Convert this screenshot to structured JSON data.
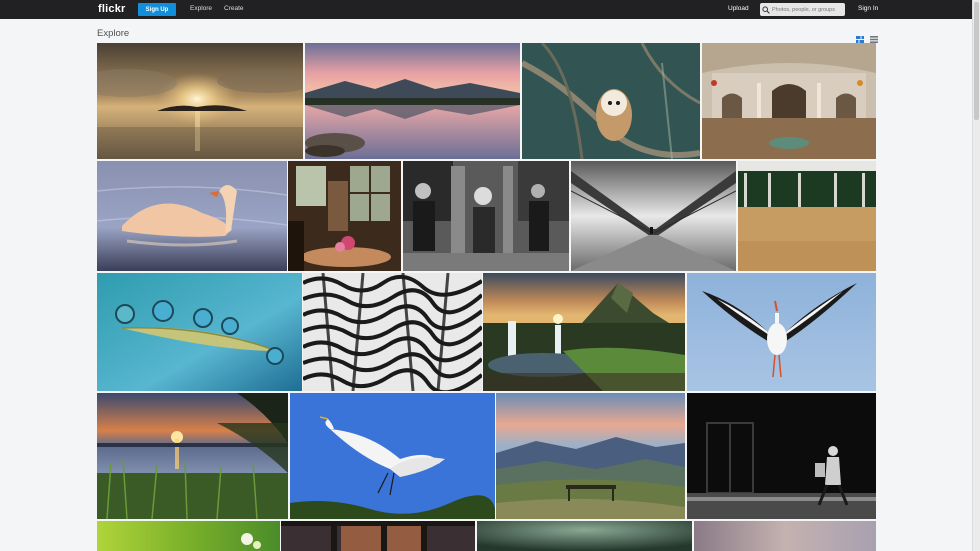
{
  "header": {
    "logo": "flickr",
    "signup_label": "Sign Up",
    "nav": {
      "explore": "Explore",
      "create": "Create",
      "upload": "Upload",
      "signin": "Sign In"
    },
    "search_placeholder": "Photos, people, or groups"
  },
  "page": {
    "title": "Explore"
  },
  "icons": {
    "search": "search-icon",
    "justified": "justified-view-icon",
    "list": "list-view-icon"
  },
  "colors": {
    "topbar": "#212124",
    "signup": "#128fdc",
    "background": "#f3f5f6"
  }
}
